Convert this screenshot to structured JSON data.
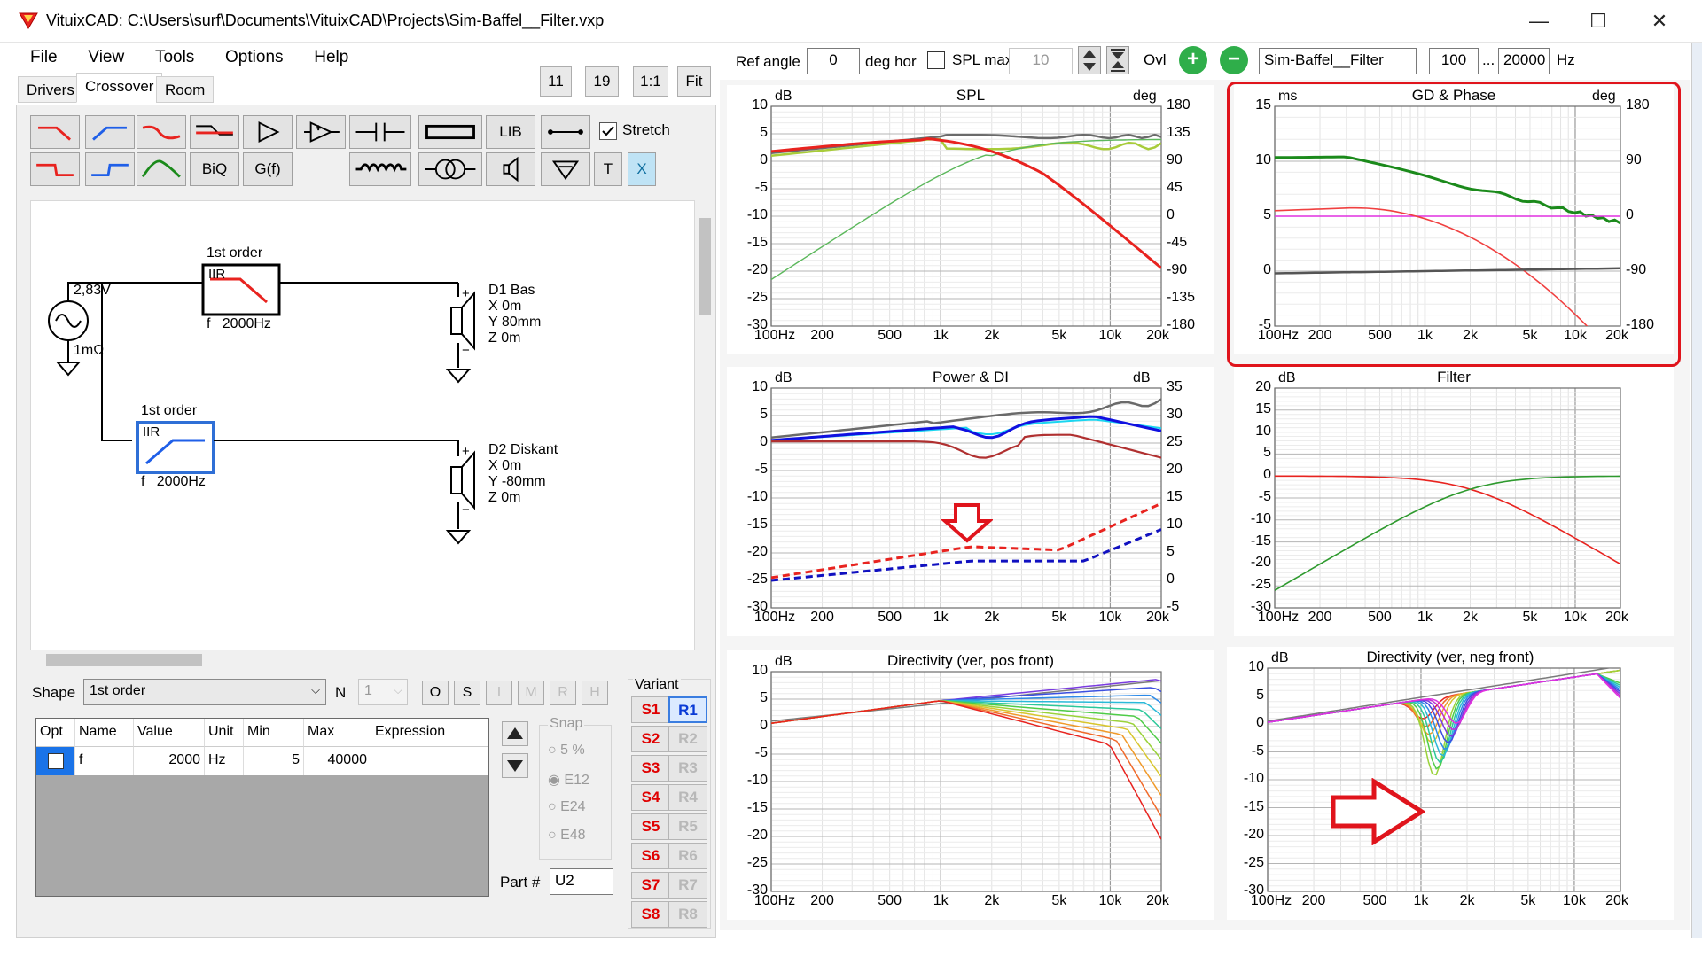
{
  "window": {
    "title": "VituixCAD: C:\\Users\\surf\\Documents\\VituixCAD\\Projects\\Sim-Baffel__Filter.vxp",
    "minimize": "—",
    "maximize": "☐",
    "close": "✕"
  },
  "menu": [
    "File",
    "View",
    "Tools",
    "Options",
    "Help"
  ],
  "tabs": [
    "Drivers",
    "Crossover",
    "Room"
  ],
  "zoom_buttons": [
    "11",
    "19",
    "1:1",
    "Fit"
  ],
  "toolbar": {
    "biq": "BiQ",
    "gf": "G(f)",
    "lib": "LIB",
    "t": "T",
    "x": "X",
    "stretch_label": "Stretch"
  },
  "schematic": {
    "source_voltage": "2,83V",
    "source_impedance": "1mΩ",
    "filter1": {
      "order": "1st order",
      "type": "IIR",
      "freq": "f   2000Hz"
    },
    "filter2": {
      "order": "1st order",
      "type": "IIR",
      "freq": "f   2000Hz"
    },
    "driver1": {
      "name": "D1 Bas",
      "x": "X 0m",
      "y": "Y 80mm",
      "z": "Z 0m"
    },
    "driver2": {
      "name": "D2 Diskant",
      "x": "X 0m",
      "y": "Y -80mm",
      "z": "Z 0m"
    },
    "plus": "+",
    "minus": "−"
  },
  "shape": {
    "label": "Shape",
    "value": "1st order",
    "n_label": "N",
    "n_value": "1",
    "buttons": [
      "O",
      "S",
      "I",
      "M",
      "R",
      "H"
    ]
  },
  "param_table": {
    "headers": [
      "Opt",
      "Name",
      "Value",
      "Unit",
      "Min",
      "Max",
      "Expression"
    ],
    "rows": [
      {
        "opt": "",
        "name": "f",
        "value": "2000",
        "unit": "Hz",
        "min": "5",
        "max": "40000",
        "expression": ""
      }
    ]
  },
  "snap": {
    "label": "Snap",
    "options": [
      "5 %",
      "E12",
      "E24",
      "E48"
    ],
    "selected": "E12"
  },
  "part": {
    "label": "Part #",
    "value": "U2"
  },
  "variant": {
    "label": "Variant",
    "s": [
      "S1",
      "S2",
      "S3",
      "S4",
      "S5",
      "S6",
      "S7",
      "S8"
    ],
    "r": [
      "R1",
      "R2",
      "R3",
      "R4",
      "R5",
      "R6",
      "R7",
      "R8"
    ],
    "active_r": "R1"
  },
  "top_controls": {
    "ref_angle_label": "Ref angle",
    "ref_angle_value": "0",
    "deg_hor": "deg hor",
    "spl_max_label": "SPL max",
    "spl_max_value": "10",
    "ovl": "Ovl",
    "plus_icon": "+",
    "minus_icon": "−",
    "name_value": "Sim-Baffel__Filter",
    "freq_min": "100",
    "range_sep": "...",
    "freq_max": "20000",
    "hz": "Hz"
  },
  "graphs": {
    "spl": {
      "title": "SPL",
      "left_unit": "dB",
      "right_unit": "deg",
      "left_ticks": [
        "10",
        "5",
        "0",
        "-5",
        "-10",
        "-15",
        "-20",
        "-25",
        "-30"
      ],
      "right_ticks": [
        "180",
        "135",
        "90",
        "45",
        "0",
        "-45",
        "-90",
        "-135",
        "-180"
      ]
    },
    "gd": {
      "title": "GD & Phase",
      "left_unit": "ms",
      "right_unit": "deg",
      "left_ticks": [
        "15",
        "10",
        "5",
        "0",
        "-5"
      ],
      "right_ticks": [
        "180",
        "90",
        "0",
        "-90",
        "-180"
      ]
    },
    "power": {
      "title": "Power & DI",
      "left_unit": "dB",
      "right_unit": "dB",
      "left_ticks": [
        "10",
        "5",
        "0",
        "-5",
        "-10",
        "-15",
        "-20",
        "-25",
        "-30"
      ],
      "right_ticks": [
        "35",
        "30",
        "25",
        "20",
        "15",
        "10",
        "5",
        "0",
        "-5"
      ]
    },
    "filter": {
      "title": "Filter",
      "left_unit": "dB",
      "left_ticks": [
        "20",
        "15",
        "10",
        "5",
        "0",
        "-5",
        "-10",
        "-15",
        "-20",
        "-25",
        "-30"
      ]
    },
    "dir_pos": {
      "title": "Directivity (ver, pos front)",
      "left_unit": "dB",
      "left_ticks": [
        "10",
        "5",
        "0",
        "-5",
        "-10",
        "-15",
        "-20",
        "-25",
        "-30"
      ]
    },
    "dir_neg": {
      "title": "Directivity (ver, neg front)",
      "left_unit": "dB",
      "left_ticks": [
        "10",
        "5",
        "0",
        "-5",
        "-10",
        "-15",
        "-20",
        "-25",
        "-30"
      ]
    },
    "x_ticks": [
      "100Hz",
      "200",
      "500",
      "1k",
      "2k",
      "5k",
      "10k",
      "20k"
    ]
  },
  "colors": {
    "red": "#e8231f",
    "green": "#1b8a1b",
    "highlight": "#e0141c",
    "blue": "#1010e0",
    "cyan": "#1ad6f0"
  }
}
